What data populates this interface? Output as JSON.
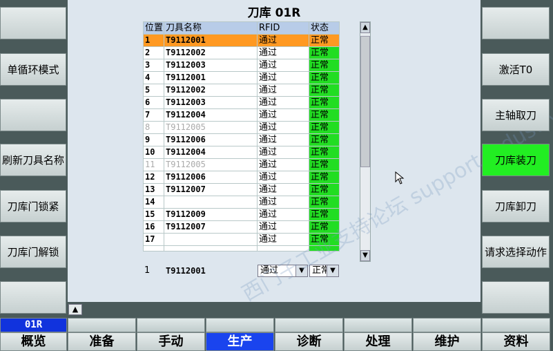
{
  "left_softkeys": [
    {
      "label": ""
    },
    {
      "label": "单循环模式"
    },
    {
      "label": ""
    },
    {
      "label": "刷新刀具名称"
    },
    {
      "label": "刀库门锁紧"
    },
    {
      "label": "刀库门解锁"
    },
    {
      "label": ""
    }
  ],
  "right_softkeys": [
    {
      "label": ""
    },
    {
      "label": "激活T0"
    },
    {
      "label": "主轴取刀"
    },
    {
      "label": "刀库装刀"
    },
    {
      "label": "刀库卸刀"
    },
    {
      "label": "请求选择动作"
    },
    {
      "label": ""
    }
  ],
  "indicators": {
    "single_cycle_led": "off",
    "door_lock_led": "on",
    "on_color": "#22cc22"
  },
  "panel": {
    "title": "刀库 01R",
    "columns": [
      "位置",
      "刀具名称",
      "RFID",
      "状态"
    ],
    "rows": [
      {
        "pos": "1",
        "name": "T9112001",
        "rfid": "通过",
        "status": "正常"
      },
      {
        "pos": "2",
        "name": "T9112002",
        "rfid": "通过",
        "status": "正常"
      },
      {
        "pos": "3",
        "name": "T9112003",
        "rfid": "通过",
        "status": "正常"
      },
      {
        "pos": "4",
        "name": "T9112001",
        "rfid": "通过",
        "status": "正常"
      },
      {
        "pos": "5",
        "name": "T9112002",
        "rfid": "通过",
        "status": "正常"
      },
      {
        "pos": "6",
        "name": "T9112003",
        "rfid": "通过",
        "status": "正常"
      },
      {
        "pos": "7",
        "name": "T9112004",
        "rfid": "通过",
        "status": "正常"
      },
      {
        "pos": "8",
        "name": "T9112005",
        "rfid": "通过",
        "status": "正常"
      },
      {
        "pos": "9",
        "name": "T9112006",
        "rfid": "通过",
        "status": "正常"
      },
      {
        "pos": "10",
        "name": "T9112004",
        "rfid": "通过",
        "status": "正常"
      },
      {
        "pos": "11",
        "name": "T9112005",
        "rfid": "通过",
        "status": "正常"
      },
      {
        "pos": "12",
        "name": "T9112006",
        "rfid": "通过",
        "status": "正常"
      },
      {
        "pos": "13",
        "name": "T9112007",
        "rfid": "通过",
        "status": "正常"
      },
      {
        "pos": "14",
        "name": "",
        "rfid": "通过",
        "status": "正常"
      },
      {
        "pos": "15",
        "name": "T9112009",
        "rfid": "通过",
        "status": "正常"
      },
      {
        "pos": "16",
        "name": "T9112007",
        "rfid": "通过",
        "status": "正常"
      },
      {
        "pos": "17",
        "name": "",
        "rfid": "通过",
        "status": "正常"
      }
    ],
    "selected_index": 0,
    "dimmed_positions": [
      "8",
      "11"
    ],
    "edit_row": {
      "pos": "1",
      "name": "T9112001",
      "rfid_select": "通过",
      "status_select": "正常"
    },
    "colors": {
      "selected": "#ff9922",
      "status_ok": "#22dd22"
    }
  },
  "channel": {
    "name": "01R"
  },
  "bottom_tabs": [
    "概览",
    "准备",
    "手动",
    "生产",
    "诊断",
    "处理",
    "维护",
    "资料"
  ],
  "active_tab": "生产",
  "watermark": "西门子工业支持论坛 support.industry.siemens.com/cs"
}
